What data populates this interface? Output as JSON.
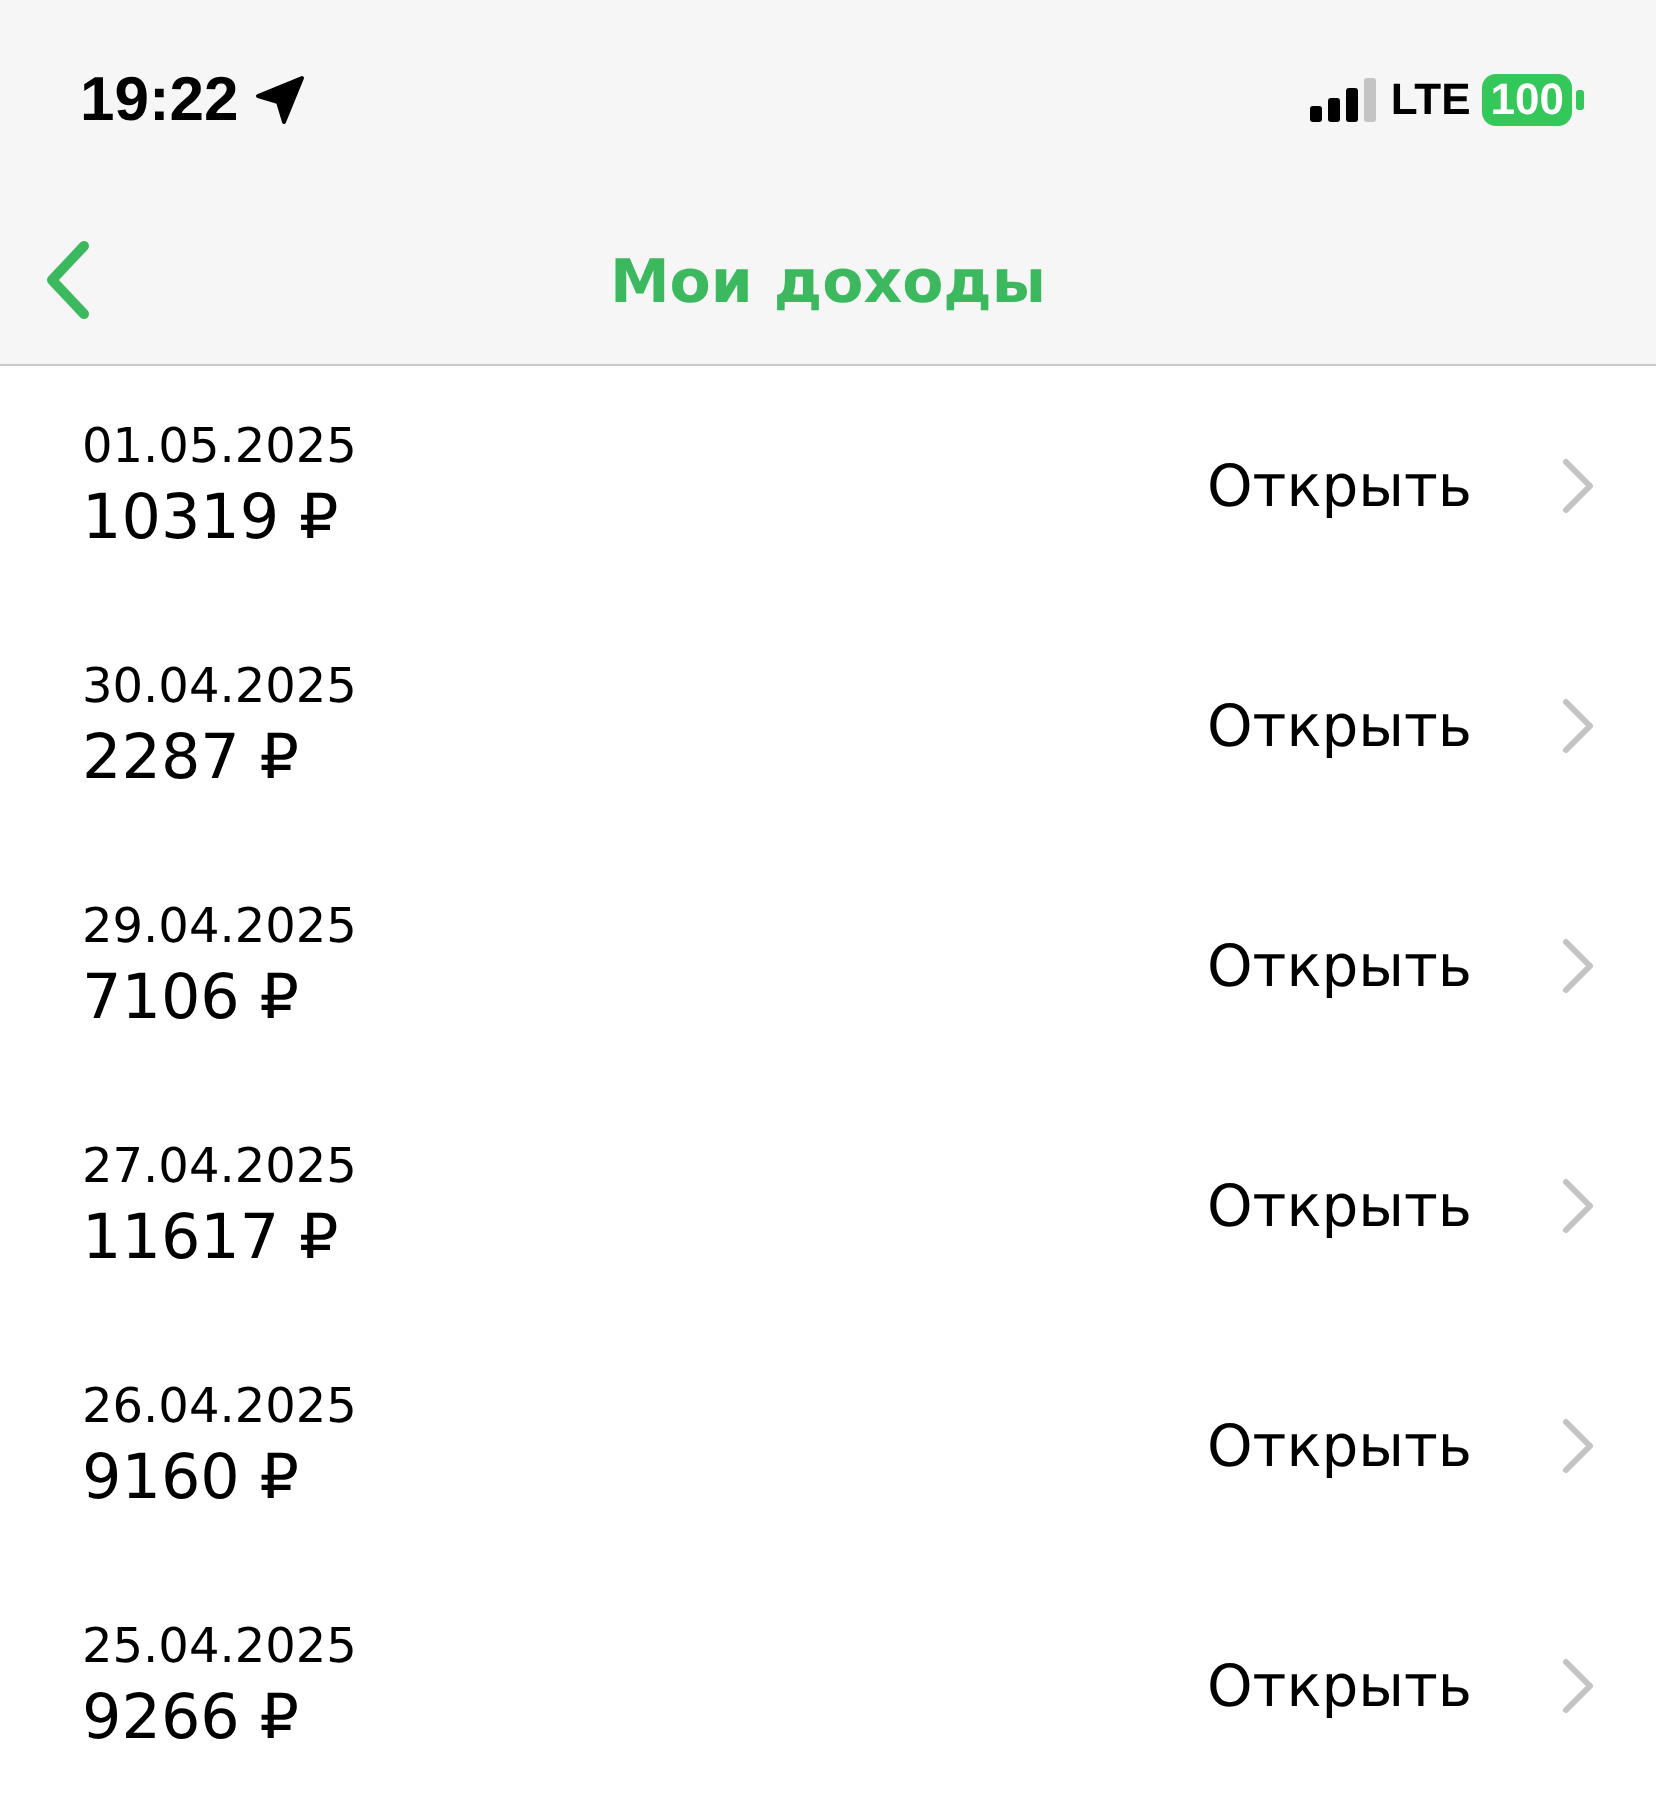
{
  "status_bar": {
    "time": "19:22",
    "network": "LTE",
    "battery": "100"
  },
  "nav": {
    "title": "Мои доходы"
  },
  "rows": [
    {
      "date": "01.05.2025",
      "amount": "10319 ₽",
      "action": "Открыть"
    },
    {
      "date": "30.04.2025",
      "amount": "2287 ₽",
      "action": "Открыть"
    },
    {
      "date": "29.04.2025",
      "amount": "7106 ₽",
      "action": "Открыть"
    },
    {
      "date": "27.04.2025",
      "amount": "11617 ₽",
      "action": "Открыть"
    },
    {
      "date": "26.04.2025",
      "amount": "9160 ₽",
      "action": "Открыть"
    },
    {
      "date": "25.04.2025",
      "amount": "9266 ₽",
      "action": "Открыть"
    }
  ]
}
